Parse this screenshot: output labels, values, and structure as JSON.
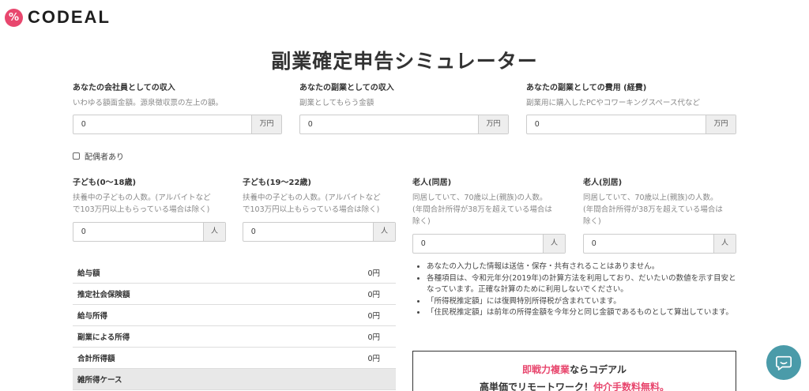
{
  "header": {
    "logo_mark": "%",
    "logo_text": "CODEAL"
  },
  "page_title": "副業確定申告シミュレーター",
  "income": {
    "company": {
      "label": "あなたの会社員としての収入",
      "desc": "いわゆる額面金額。源泉徴収票の左上の額。",
      "value": "0",
      "unit": "万円"
    },
    "side": {
      "label": "あなたの副業としての収入",
      "desc": "副業としてもらう金額",
      "value": "0",
      "unit": "万円"
    },
    "expense": {
      "label": "あなたの副業としての費用 (経費)",
      "desc": "副業用に購入したPCやコワーキングスペース代など",
      "value": "0",
      "unit": "万円"
    }
  },
  "spouse": {
    "label": "配偶者あり",
    "checked": false
  },
  "dependents": {
    "child1": {
      "label": "子ども(0〜18歳)",
      "desc1": "扶養中の子どもの人数。(アルバイトなど",
      "desc2": "で103万円以上もらっている場合は除く)",
      "value": "0",
      "unit": "人"
    },
    "child2": {
      "label": "子ども(19〜22歳)",
      "desc1": "扶養中の子どもの人数。(アルバイトなど",
      "desc2": "で103万円以上もらっている場合は除く)",
      "value": "0",
      "unit": "人"
    },
    "elder_together": {
      "label": "老人(同居)",
      "desc1": "同居していて、70歳以上(親族)の人数。",
      "desc2": "(年間合計所得が38万を超えている場合は",
      "desc3": "除く)",
      "value": "0",
      "unit": "人"
    },
    "elder_separate": {
      "label": "老人(別居)",
      "desc1": "同居していて、70歳以上(親族)の人数。",
      "desc2": "(年間合計所得が38万を超えている場合は",
      "desc3": "除く)",
      "value": "0",
      "unit": "人"
    }
  },
  "results": [
    {
      "label": "給与額",
      "value": "0円"
    },
    {
      "label": "推定社会保険額",
      "value": "0円"
    },
    {
      "label": "給与所得",
      "value": "0円"
    },
    {
      "label": "副業による所得",
      "value": "0円"
    },
    {
      "label": "合計所得額",
      "value": "0円"
    },
    {
      "label": "雑所得ケース",
      "value": ""
    }
  ],
  "notes": [
    "あなたの入力した情報は送信・保存・共有されることはありません。",
    "各種項目は、令和元年分(2019年)の計算方法を利用しており、だいたいの数値を示す目安となっています。正確な計算のために利用しないでください。",
    "「所得税推定額」には復興特別所得税が含まれています。",
    "「住民税推定額」は前年の所得金額を今年分と同じ金額であるものとして算出しています。"
  ],
  "promo": {
    "line1_pink": "即戦力複業",
    "line1_rest": "ならコデアル",
    "line2_rest": "高単価でリモートワーク！",
    "line2_pink": "仲介手数料無料。"
  },
  "colors": {
    "brand": "#e8476e",
    "chat": "#4a9ba9"
  },
  "chat": {
    "icon": "chat-bubble-icon"
  }
}
